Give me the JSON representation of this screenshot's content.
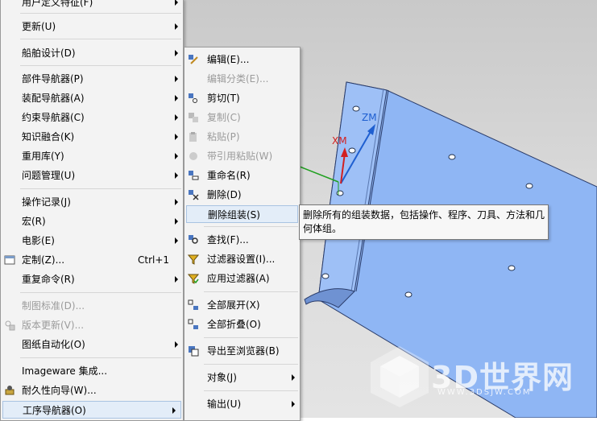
{
  "main_menu": {
    "items": [
      {
        "label": "用户定义特征(F)",
        "submenu": true
      },
      {
        "label": "更新(U)",
        "submenu": true
      },
      {
        "label": "船舶设计(D)",
        "submenu": true
      },
      {
        "label": "部件导航器(P)",
        "submenu": true
      },
      {
        "label": "装配导航器(A)",
        "submenu": true
      },
      {
        "label": "约束导航器(C)",
        "submenu": true
      },
      {
        "label": "知识融合(K)",
        "submenu": true
      },
      {
        "label": "重用库(Y)",
        "submenu": true
      },
      {
        "label": "问题管理(U)",
        "submenu": true
      },
      {
        "label": "操作记录(J)",
        "submenu": true
      },
      {
        "label": "宏(R)",
        "submenu": true
      },
      {
        "label": "电影(E)",
        "submenu": true
      },
      {
        "label": "定制(Z)...",
        "shortcut": "Ctrl+1",
        "icon": "customize-icon"
      },
      {
        "label": "重复命令(R)",
        "submenu": true
      },
      {
        "label": "制图标准(D)...",
        "disabled": true
      },
      {
        "label": "版本更新(V)...",
        "disabled": true,
        "icon": "version-update-icon"
      },
      {
        "label": "图纸自动化(O)",
        "submenu": true
      },
      {
        "label": "Imageware 集成..."
      },
      {
        "label": "耐久性向导(W)...",
        "icon": "durability-wizard-icon"
      },
      {
        "label": "工序导航器(O)",
        "submenu": true,
        "highlighted": true
      }
    ]
  },
  "sub_menu": {
    "items": [
      {
        "label": "编辑(E)...",
        "icon": "edit-icon"
      },
      {
        "label": "编辑分类(E)...",
        "disabled": true
      },
      {
        "label": "剪切(T)",
        "icon": "cut-icon"
      },
      {
        "label": "复制(C)",
        "disabled": true,
        "icon": "copy-icon"
      },
      {
        "label": "粘贴(P)",
        "disabled": true,
        "icon": "paste-icon"
      },
      {
        "label": "带引用粘贴(W)",
        "disabled": true,
        "icon": "paste-reference-icon"
      },
      {
        "label": "重命名(R)",
        "icon": "rename-icon"
      },
      {
        "label": "删除(D)",
        "icon": "delete-icon"
      },
      {
        "label": "删除组装(S)",
        "highlighted": true
      },
      {
        "label": "查找(F)...",
        "icon": "find-icon"
      },
      {
        "label": "过滤器设置(I)...",
        "icon": "filter-settings-icon"
      },
      {
        "label": "应用过滤器(A)",
        "icon": "apply-filter-icon"
      },
      {
        "label": "全部展开(X)",
        "icon": "expand-all-icon"
      },
      {
        "label": "全部折叠(O)",
        "icon": "collapse-all-icon"
      },
      {
        "label": "导出至浏览器(B)",
        "icon": "export-browser-icon"
      },
      {
        "label": "对象(J)",
        "submenu": true
      },
      {
        "label": "输出(U)",
        "submenu": true
      }
    ]
  },
  "tooltip": {
    "text": "删除所有的组装数据，包括操作、程序、刀具、方法和几何体组。"
  },
  "viewport": {
    "axis_labels": {
      "zm": "ZM",
      "xm": "XM"
    },
    "colors": {
      "part": "#8db4f2",
      "zm": "#1f5fd0",
      "xm": "#d22020",
      "green": "#20a020"
    }
  },
  "watermark": {
    "text": "3D世界网",
    "url": "WWW.3DSJW.COM"
  }
}
